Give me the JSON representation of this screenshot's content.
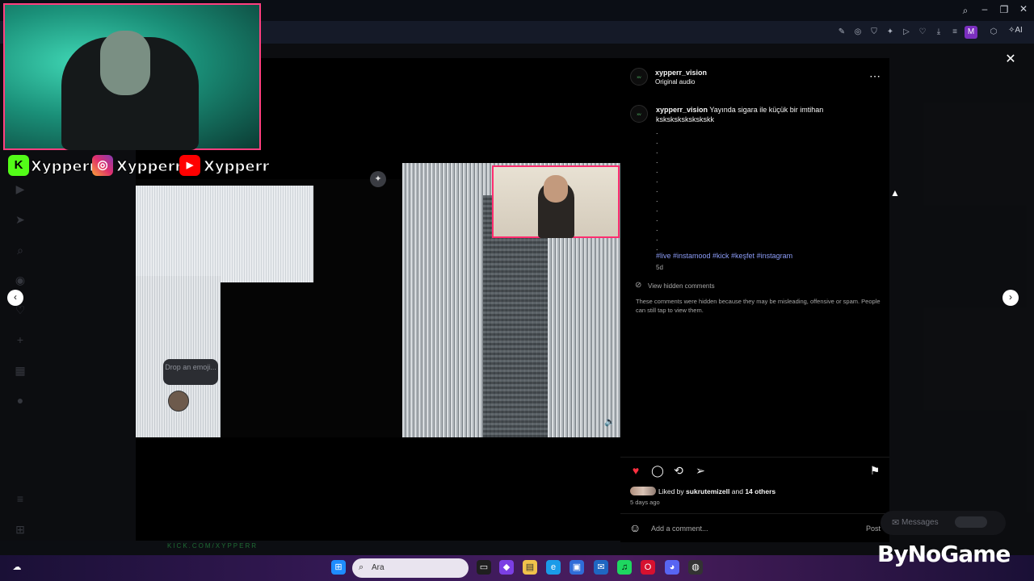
{
  "post": {
    "username": "xypperr_vision",
    "audio": "Original audio",
    "caption_user": "xypperr_vision",
    "caption_text": "Yayında sigara ile küçük bir imtihan",
    "caption_line2": "kskskskskskskskk",
    "hashtags": "#live #instamood #kick #keşfet #instagram",
    "age": "5d",
    "view_hidden": "View hidden comments",
    "hidden_note": "These comments were hidden because they may be misleading, offensive or spam. People can still tap to view them.",
    "liked_by_prefix": "Liked by",
    "liked_by_user": "sukrutemizell",
    "liked_by_and": "and",
    "liked_by_others": "14 others",
    "date": "5 days ago",
    "comment_placeholder": "Add a comment...",
    "post_button": "Post"
  },
  "media": {
    "drop_emoji": "Drop an emoji..."
  },
  "overlay": {
    "streamer_names": [
      "Xypperr",
      "Xypperr",
      "Xypperr"
    ],
    "kick_url": "KICK.COM/XYPPERR",
    "watermark": "ByNoGame"
  },
  "messages": {
    "label": "Messages"
  },
  "taskbar": {
    "search_placeholder": "Ara",
    "profile_initial": "M",
    "ai_label": "AI"
  },
  "colors": {
    "like": "#ff3040",
    "hashtag": "#8c9cf7",
    "webcam_border": "#ff3f7f"
  },
  "icons": [
    "search-icon",
    "minimize-icon",
    "restore-icon",
    "close-icon",
    "heart-icon",
    "comment-icon",
    "repost-icon",
    "share-icon",
    "bookmark-icon",
    "more-icon",
    "emoji-icon",
    "chevron-left-icon",
    "chevron-right-icon"
  ]
}
